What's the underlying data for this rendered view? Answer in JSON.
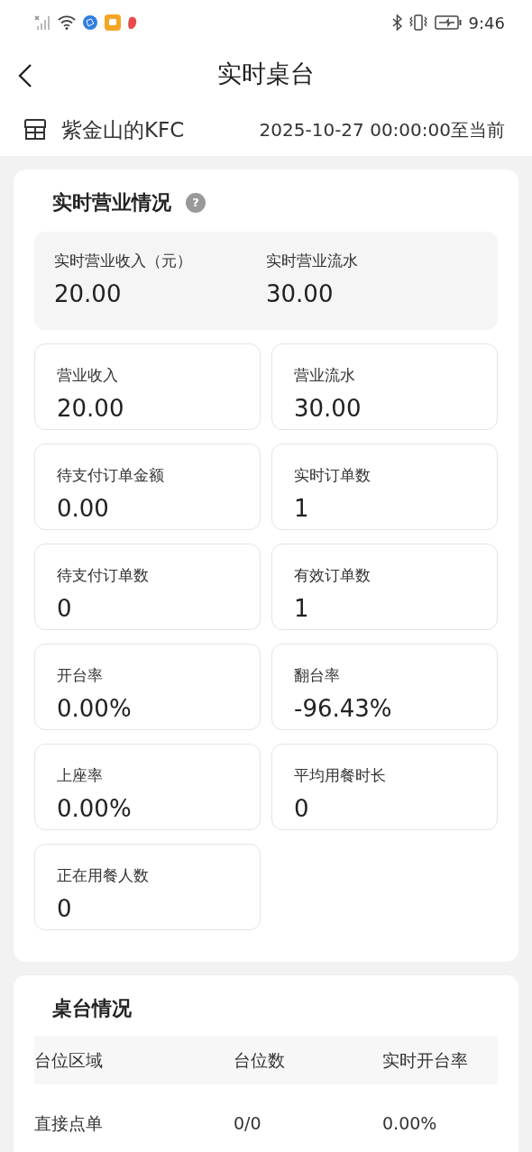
{
  "status_bar": {
    "time": "9:46"
  },
  "header": {
    "title": "实时桌台"
  },
  "store": {
    "name": "紫金山的KFC",
    "period": "2025-10-27 00:00:00至当前"
  },
  "business": {
    "title": "实时营业情况",
    "help_mark": "?",
    "highlights": [
      {
        "label": "实时营业收入（元）",
        "value": "20.00"
      },
      {
        "label": "实时营业流水",
        "value": "30.00"
      }
    ],
    "metrics": [
      {
        "label": "营业收入",
        "value": "20.00"
      },
      {
        "label": "营业流水",
        "value": "30.00"
      },
      {
        "label": "待支付订单金额",
        "value": "0.00"
      },
      {
        "label": "实时订单数",
        "value": "1"
      },
      {
        "label": "待支付订单数",
        "value": "0"
      },
      {
        "label": "有效订单数",
        "value": "1"
      },
      {
        "label": "开台率",
        "value": "0.00%"
      },
      {
        "label": "翻台率",
        "value": "-96.43%"
      },
      {
        "label": "上座率",
        "value": "0.00%"
      },
      {
        "label": "平均用餐时长",
        "value": "0"
      },
      {
        "label": "正在用餐人数",
        "value": "0"
      }
    ]
  },
  "tables": {
    "title": "桌台情况",
    "columns": [
      "台位区域",
      "台位数",
      "实时开台率"
    ],
    "rows": [
      [
        "直接点单",
        "0/0",
        "0.00%"
      ]
    ]
  }
}
